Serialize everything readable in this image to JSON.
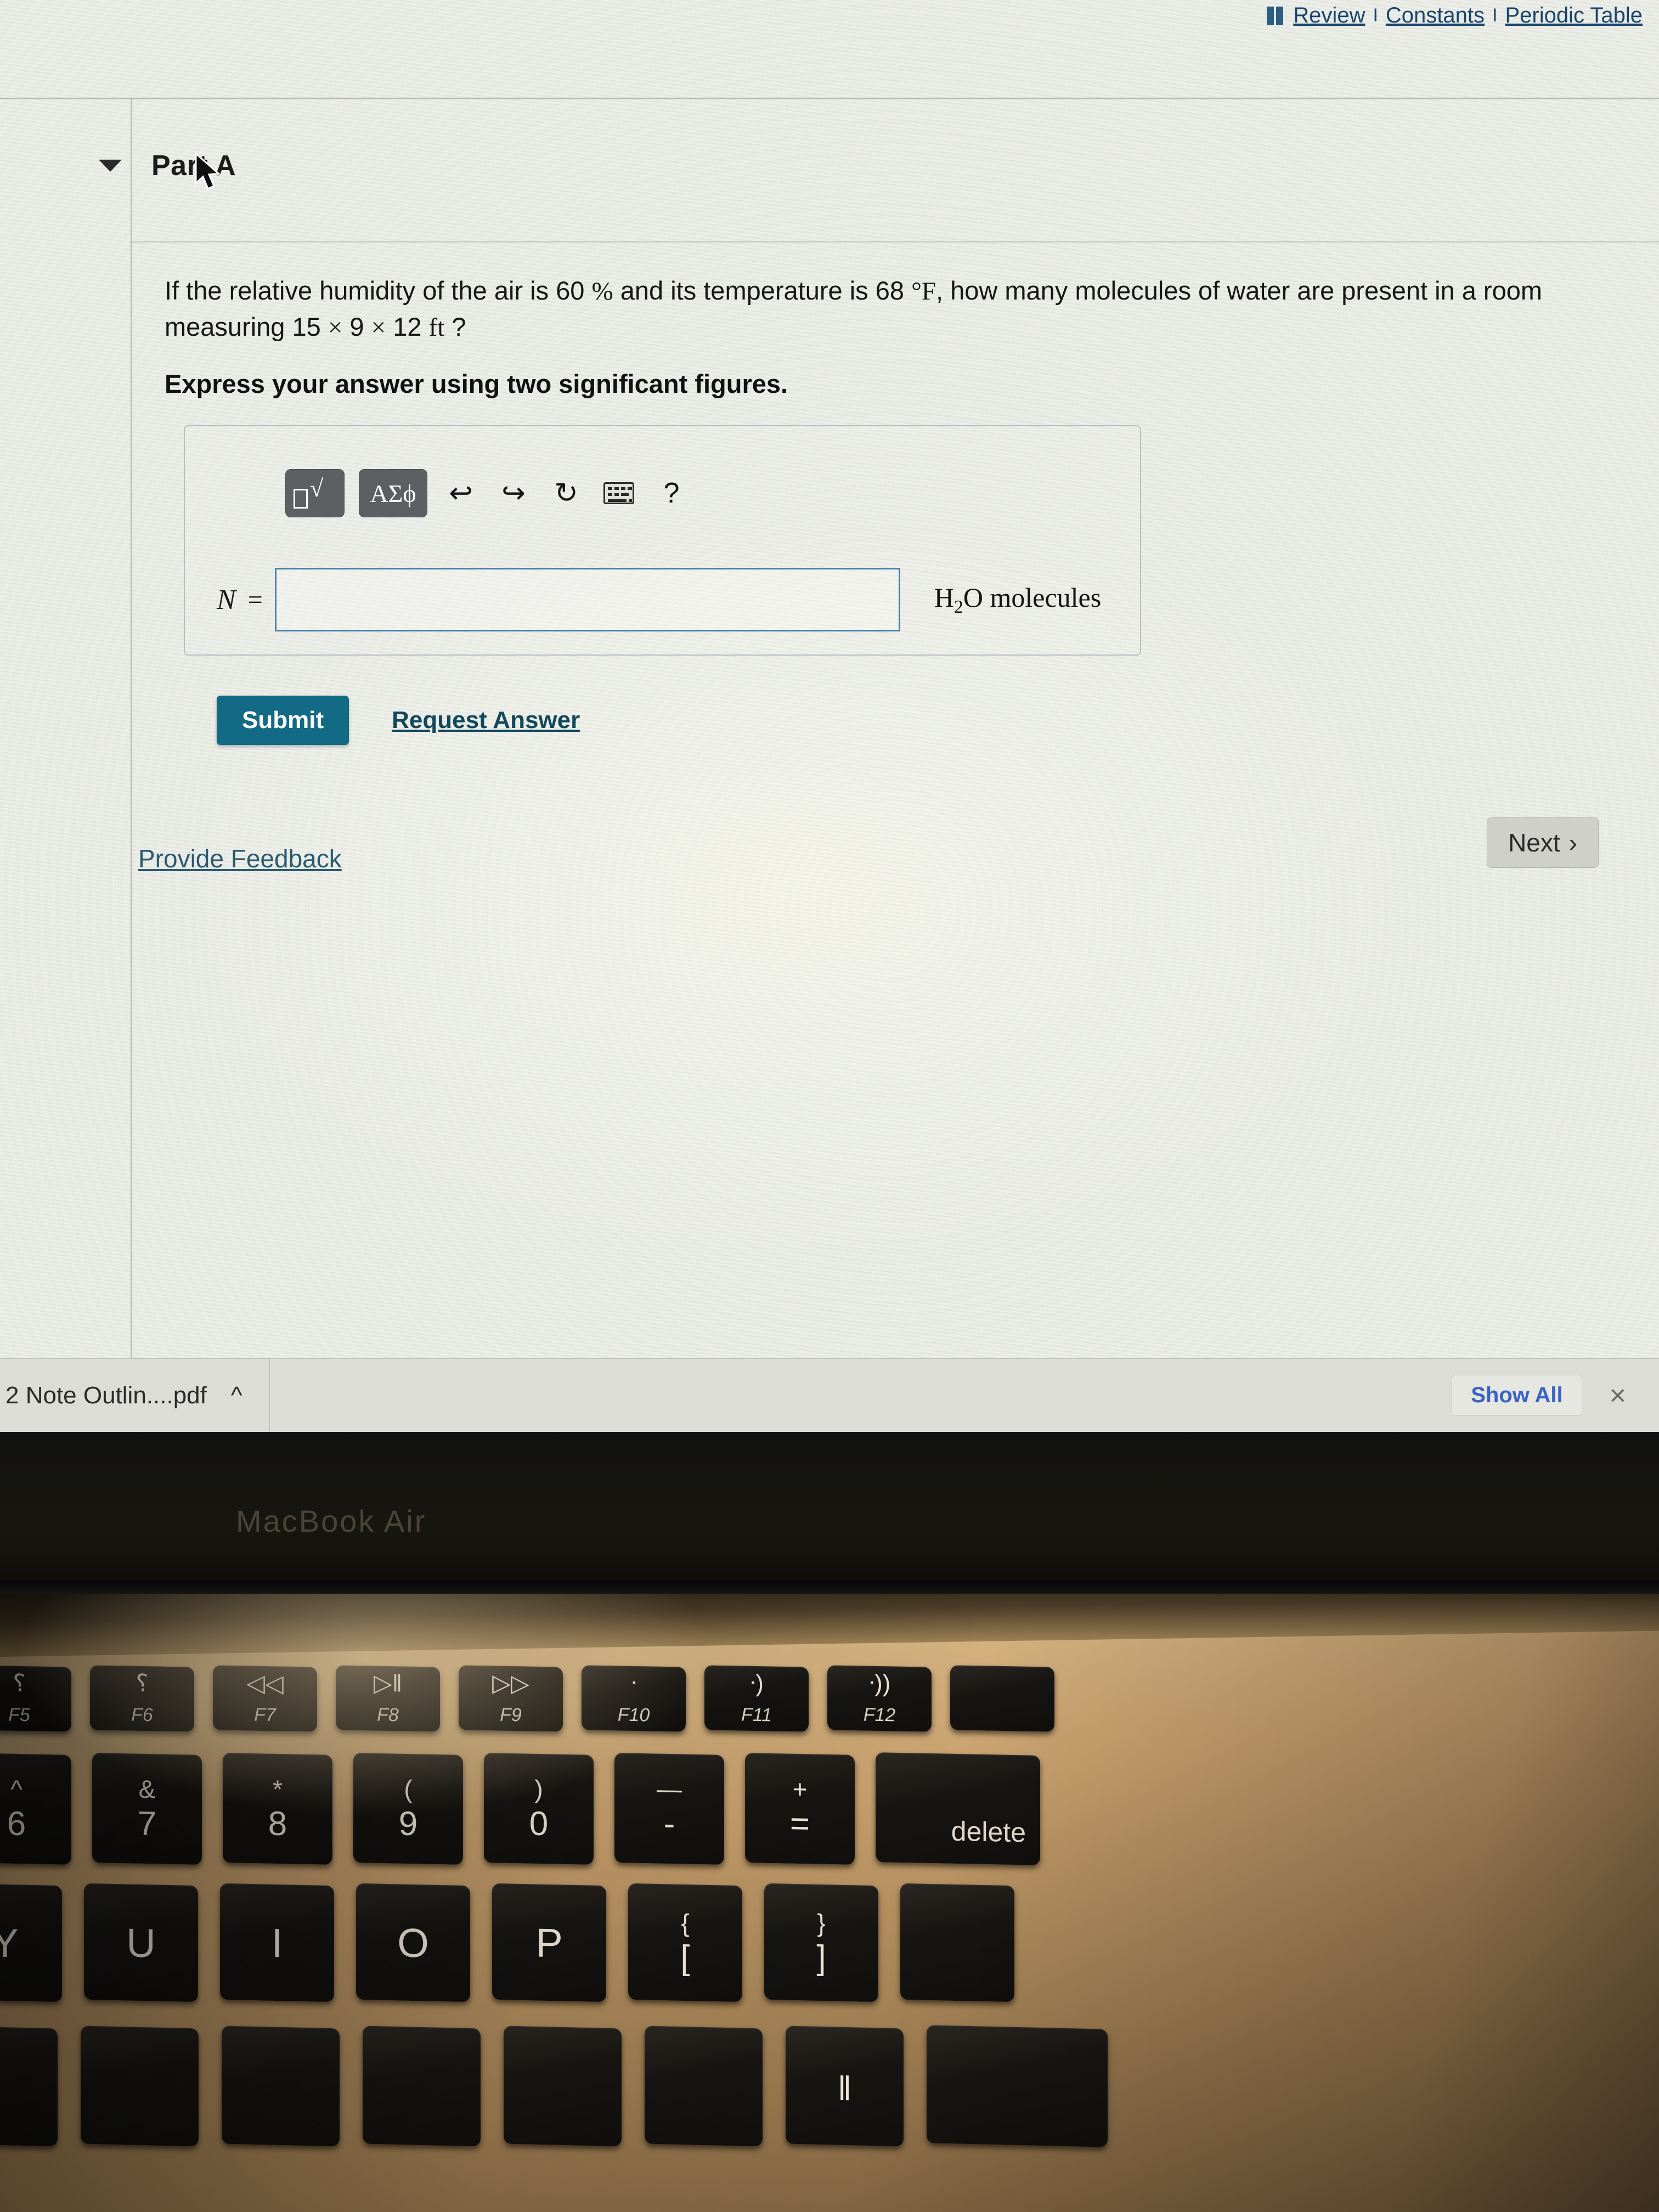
{
  "header": {
    "book_icon": "book-icon",
    "links": [
      "Review",
      "Constants",
      "Periodic Table"
    ],
    "separator": "I"
  },
  "part": {
    "toggle_icon": "triangle-down-icon",
    "title": "Part A"
  },
  "question": {
    "line1_a": "If the relative humidity of the air is 60",
    "percent": "%",
    "line1_b": "and its temperature is 68",
    "degree_f": "°F",
    "line1_c": ", how many molecules of water are present in a room",
    "line2_a": "measuring 15",
    "times1": "×",
    "dim2": "9",
    "times2": "×",
    "dim3": "12",
    "unit": "ft",
    "qmark": "?",
    "instruction": "Express your answer using two significant figures."
  },
  "mathbar": {
    "template_button": "√",
    "greek_button": "ΑΣϕ",
    "undo_icon": "↩",
    "redo_icon": "↪",
    "reset_icon": "↻",
    "keyboard_icon": "keyboard-icon",
    "help_icon": "?"
  },
  "answer": {
    "variable": "N",
    "equals": "=",
    "value": "",
    "placeholder": "",
    "units_pre": "H",
    "units_sub": "2",
    "units_post": "O molecules"
  },
  "actions": {
    "submit": "Submit",
    "request_answer": "Request Answer",
    "provide_feedback": "Provide Feedback",
    "next": "Next",
    "next_chevron": "›"
  },
  "downloads": {
    "file_name": "2 Note Outlin....pdf",
    "chevron_icon": "^",
    "show_all": "Show All",
    "close_icon": "×"
  },
  "laptop": {
    "bezel_label": "MacBook Air"
  },
  "keyboard": {
    "function_row": [
      {
        "sym": "keyboard-backlight-low-icon",
        "glyph": "⸮",
        "label": "F5"
      },
      {
        "sym": "keyboard-backlight-high-icon",
        "glyph": "⸮",
        "label": "F6"
      },
      {
        "sym": "rewind-icon",
        "glyph": "◁◁",
        "label": "F7"
      },
      {
        "sym": "play-pause-icon",
        "glyph": "▷‖",
        "label": "F8"
      },
      {
        "sym": "fast-forward-icon",
        "glyph": "▷▷",
        "label": "F9"
      },
      {
        "sym": "mute-icon",
        "glyph": "ᐧ",
        "label": "F10"
      },
      {
        "sym": "volume-down-icon",
        "glyph": "ᐧ)",
        "label": "F11"
      },
      {
        "sym": "volume-up-icon",
        "glyph": "ᐧ))",
        "label": "F12"
      },
      {
        "sym": "blank-key",
        "glyph": "",
        "label": ""
      }
    ],
    "number_row": [
      {
        "upper": "^",
        "lower": "6"
      },
      {
        "upper": "&",
        "lower": "7"
      },
      {
        "upper": "*",
        "lower": "8"
      },
      {
        "upper": "(",
        "lower": "9"
      },
      {
        "upper": ")",
        "lower": "0"
      },
      {
        "upper": "—",
        "lower": "-"
      },
      {
        "upper": "+",
        "lower": "="
      },
      {
        "upper": "",
        "lower": "delete"
      }
    ],
    "letter_row": [
      {
        "label": "Y"
      },
      {
        "label": "U"
      },
      {
        "label": "I"
      },
      {
        "label": "O"
      },
      {
        "label": "P"
      },
      {
        "upper": "{",
        "lower": "["
      },
      {
        "upper": "}",
        "lower": "]"
      },
      {
        "label": ""
      }
    ],
    "bottom_row": [
      {
        "label": ""
      },
      {
        "label": ""
      },
      {
        "label": ""
      },
      {
        "label": ""
      },
      {
        "label": ""
      },
      {
        "label": ""
      },
      {
        "label": "‖"
      },
      {
        "label": ""
      }
    ]
  },
  "colors": {
    "link": "#19456b",
    "submit_bg": "#126a85",
    "input_border": "#4a7fa8",
    "show_all_text": "#3a62c6",
    "screen_bg": "#e7e8e3"
  }
}
